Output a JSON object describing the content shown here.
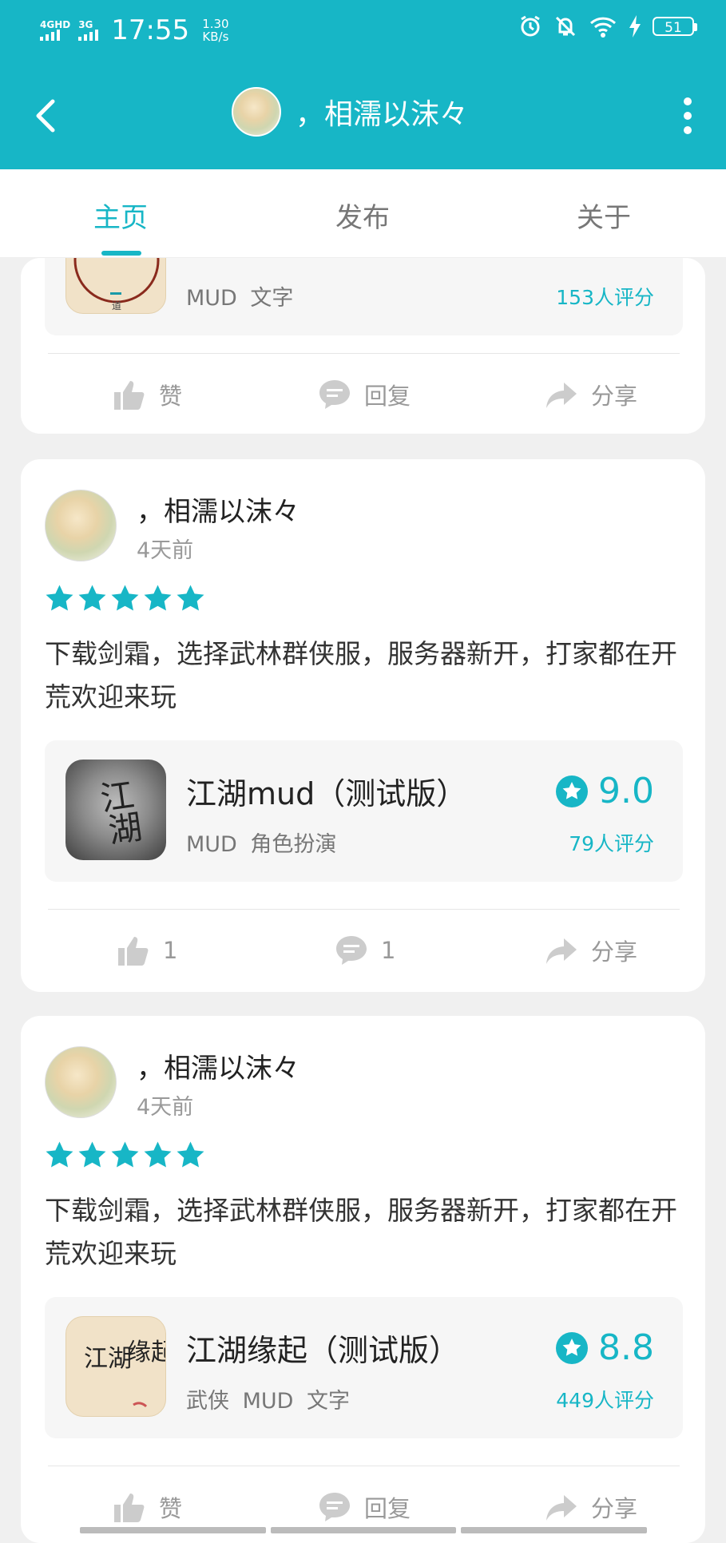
{
  "status_bar": {
    "network_1": "4GHD",
    "network_2": "3G",
    "time": "17:55",
    "speed_value": "1.30",
    "speed_unit": "KB/s",
    "battery": "51"
  },
  "header": {
    "title": "，相濡以沫々"
  },
  "tabs": [
    {
      "label": "主页",
      "active": true
    },
    {
      "label": "发布",
      "active": false
    },
    {
      "label": "关于",
      "active": false
    }
  ],
  "post_partial": {
    "app_tags": "MUD   文字",
    "app_ratings": "153人评分",
    "actions": {
      "like": "赞",
      "reply": "回复",
      "share": "分享"
    }
  },
  "posts": [
    {
      "user": "，相濡以沫々",
      "time": "4天前",
      "stars": 5,
      "text": "下载剑霜，选择武林群侠服，服务器新开，打家都在开荒欢迎来玩",
      "app": {
        "name": "江湖mud（测试版）",
        "tags": "MUD   角色扮演",
        "score": "9.0",
        "ratings": "79人评分",
        "icon_text": "江湖"
      },
      "actions": {
        "like": "1",
        "reply": "1",
        "share": "分享"
      }
    },
    {
      "user": "，相濡以沫々",
      "time": "4天前",
      "stars": 5,
      "text": "下载剑霜，选择武林群侠服，服务器新开，打家都在开荒欢迎来玩",
      "app": {
        "name": "江湖缘起（测试版）",
        "tags": "武侠   MUD   文字",
        "score": "8.8",
        "ratings": "449人评分",
        "icon_text_l": "江湖",
        "icon_text_r": "缘起"
      },
      "actions": {
        "like": "赞",
        "reply": "回复",
        "share": "分享"
      }
    }
  ],
  "colors": {
    "accent": "#17b6c6",
    "background": "#f0f0f0"
  }
}
